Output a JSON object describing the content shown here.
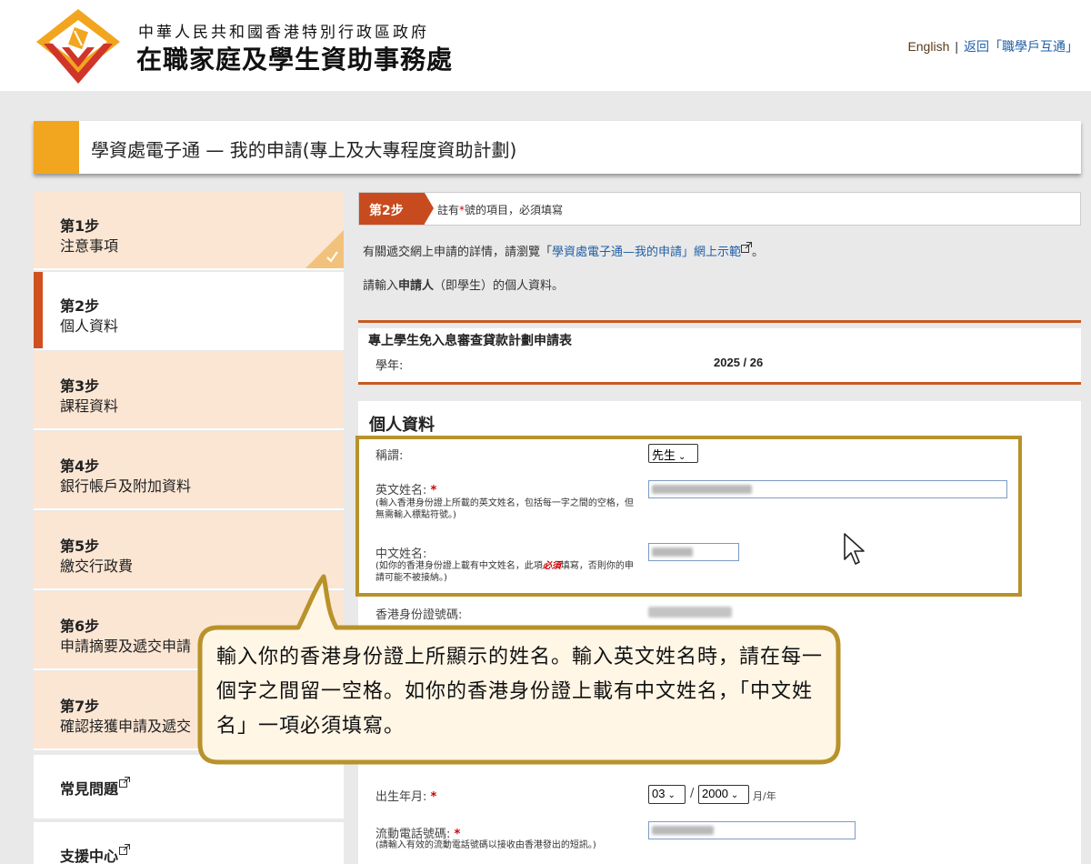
{
  "header": {
    "org_line1": "中華人民共和國香港特別行政區政府",
    "org_line2": "在職家庭及學生資助事務處",
    "lang_english": "English",
    "separator": "|",
    "back_link": "返回「職學戶互通」"
  },
  "title": "學資處電子通 — 我的申請(專上及大專程度資助計劃)",
  "sidebar": {
    "steps": [
      {
        "num": "第1步",
        "name": "注意事項"
      },
      {
        "num": "第2步",
        "name": "個人資料"
      },
      {
        "num": "第3步",
        "name": "課程資料"
      },
      {
        "num": "第4步",
        "name": "銀行帳戶及附加資料"
      },
      {
        "num": "第5步",
        "name": "繳交行政費"
      },
      {
        "num": "第6步",
        "name": "申請摘要及遞交申請"
      },
      {
        "num": "第7步",
        "name": "確認接獲申請及遞交"
      }
    ],
    "links": [
      {
        "label": "常見問題"
      },
      {
        "label": "支援中心"
      }
    ]
  },
  "main": {
    "step_tag": "第2步",
    "step_note_pre": "註有",
    "step_note_star": "*",
    "step_note_post": "號的項目，必須填寫",
    "info_pre": "有關遞交網上申請的詳情，請瀏覽「",
    "info_link": "學資處電子通—我的申請」網上示範",
    "info_post": "。",
    "instr_pre": "請輸入",
    "instr_bold": "申請人",
    "instr_post": "（即學生）的個人資料。",
    "form_title": "專上學生免入息審查貸款計劃申請表",
    "year_label": "學年:",
    "year_value": "2025 / 26",
    "personal_title": "個人資料",
    "fields": {
      "salutation_label": "稱謂:",
      "salutation_value": "先生",
      "eng_name_label": "英文姓名:",
      "eng_name_help": "(輸入香港身份證上所載的英文姓名，包括每一字之間的空格，但無需輸入標點符號。)",
      "chi_name_label": "中文姓名:",
      "chi_name_help_pre": "(如你的香港身份證上載有中文姓名，此項",
      "chi_name_help_must": "必須",
      "chi_name_help_post": "填寫，否則你的申請可能不被接納。)",
      "hkid_label": "香港身份證號碼:",
      "dob_label": "出生年月:",
      "dob_month": "03",
      "dob_sep": "/",
      "dob_year": "2000",
      "dob_unit": "月/年",
      "mobile_label": "流動電話號碼:",
      "mobile_help": "(請輸入有效的流動電話號碼以接收由香港發出的短訊。)",
      "req_mark": "*"
    }
  },
  "callout": {
    "text": "輸入你的香港身份證上所顯示的姓名。輸入英文姓名時，請在每一個字之間留一空格。如你的香港身份證上載有中文姓名，「中文姓名」一項必須填寫。"
  },
  "colors": {
    "accent_orange": "#f2a51e",
    "step_red": "#c74b1e",
    "highlight_gold": "#b8922a",
    "callout_bg": "#fff6e6",
    "link_blue": "#1f5fa8"
  }
}
